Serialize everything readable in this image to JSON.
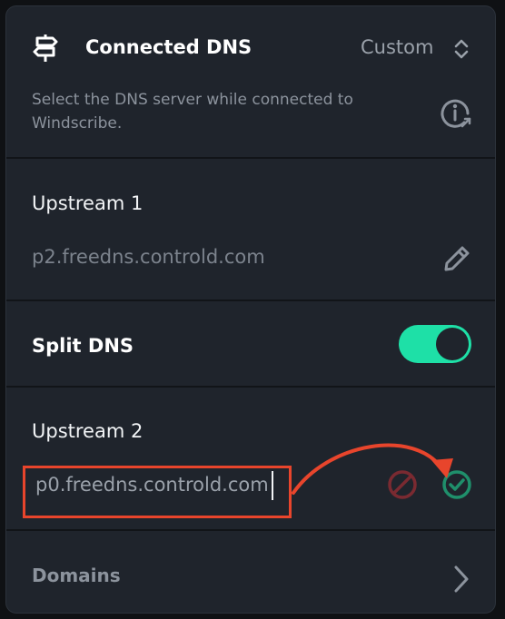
{
  "header": {
    "title": "Connected DNS",
    "mode_value": "Custom",
    "description": "Select the DNS server while connected to Windscribe."
  },
  "upstream1": {
    "label": "Upstream 1",
    "value": "p2.freedns.controld.com"
  },
  "split_dns": {
    "label": "Split DNS",
    "enabled": true
  },
  "upstream2": {
    "label": "Upstream 2",
    "input_value": "p0.freedns.controld.com"
  },
  "domains": {
    "label": "Domains"
  },
  "colors": {
    "panel_bg": "#1f242c",
    "toggle_on": "#1ee0a7",
    "confirm": "#1f8f6b",
    "cancel": "#7a2a31",
    "annotation": "#e8452c"
  }
}
